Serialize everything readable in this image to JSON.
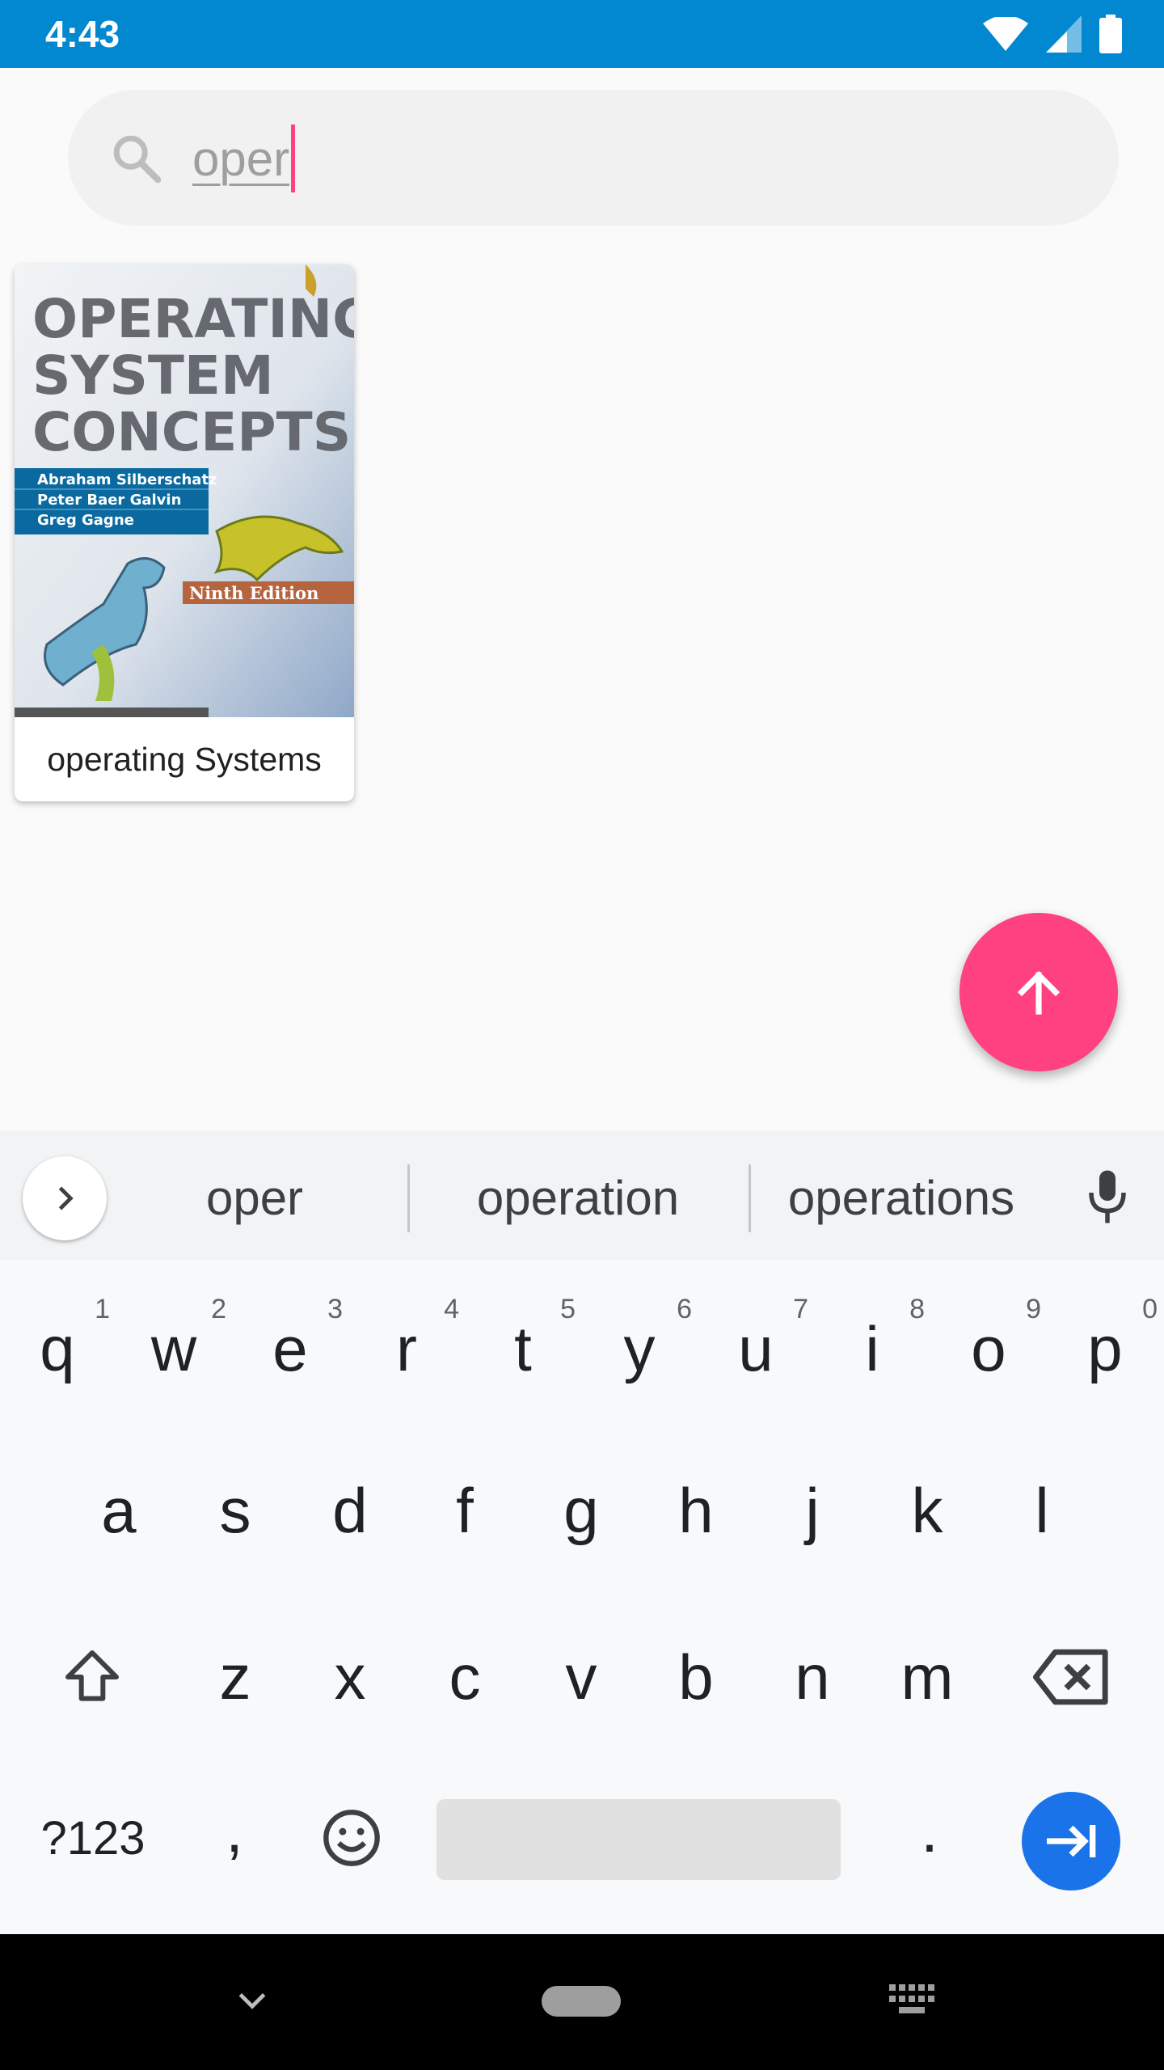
{
  "status_bar": {
    "time": "4:43",
    "icons": [
      "wifi-icon",
      "signal-icon",
      "battery-icon"
    ],
    "color": "#0288d1"
  },
  "search": {
    "query": "oper",
    "icon": "search-icon"
  },
  "results": [
    {
      "title": "operating Systems",
      "cover": {
        "title_lines": [
          "OPERATING",
          "SYSTEM",
          "CONCEPTS"
        ],
        "authors": [
          "Abraham Silberschatz",
          "Peter Baer Galvin",
          "Greg Gagne"
        ],
        "edition": "Ninth Edition"
      }
    }
  ],
  "fab": {
    "icon": "arrow-up-icon",
    "color": "#ff4081"
  },
  "keyboard": {
    "suggestions": [
      "oper",
      "operation",
      "operations"
    ],
    "row1": [
      {
        "k": "q",
        "h": "1"
      },
      {
        "k": "w",
        "h": "2"
      },
      {
        "k": "e",
        "h": "3"
      },
      {
        "k": "r",
        "h": "4"
      },
      {
        "k": "t",
        "h": "5"
      },
      {
        "k": "y",
        "h": "6"
      },
      {
        "k": "u",
        "h": "7"
      },
      {
        "k": "i",
        "h": "8"
      },
      {
        "k": "o",
        "h": "9"
      },
      {
        "k": "p",
        "h": "0"
      }
    ],
    "row2": [
      "a",
      "s",
      "d",
      "f",
      "g",
      "h",
      "j",
      "k",
      "l"
    ],
    "row3": [
      "z",
      "x",
      "c",
      "v",
      "b",
      "n",
      "m"
    ],
    "symbols_label": "?123",
    "comma": ",",
    "period": ".",
    "accent_color": "#1a73e8"
  },
  "nav_bar": {
    "icons": [
      "chevron-down-icon",
      "home-pill-icon",
      "keyboard-icon"
    ]
  }
}
